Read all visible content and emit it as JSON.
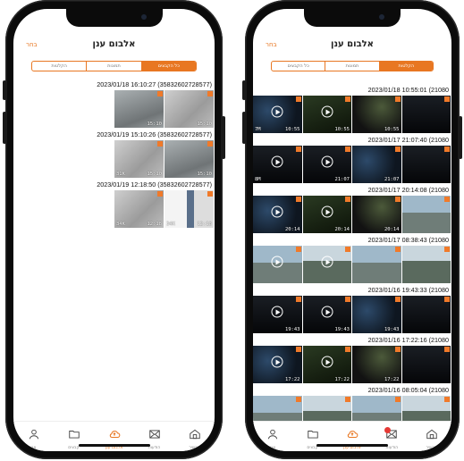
{
  "left": {
    "title": "אלבום ענן",
    "select_label": "בחר",
    "tabs": [
      {
        "label": "הקלטות",
        "active": false
      },
      {
        "label": "תמונות",
        "active": false
      },
      {
        "label": "כל הקבצים",
        "active": true
      }
    ],
    "groups": [
      {
        "header": "2023/01/18 16:10:27 (35832602728577)",
        "thumbs": [
          {
            "style": "t-grey2",
            "left": "",
            "right": "15:10"
          },
          {
            "style": "t-grey",
            "left": "",
            "right": "15:10"
          }
        ]
      },
      {
        "header": "2023/01/19 15:10:26 (35832602728577)",
        "thumbs": [
          {
            "style": "t-grey",
            "left": "31K",
            "right": "15:10"
          },
          {
            "style": "t-grey2",
            "left": "",
            "right": "15:10"
          }
        ]
      },
      {
        "header": "2023/01/19 12:18:50 (35832602728577)",
        "thumbs": [
          {
            "style": "t-grey",
            "left": "34K",
            "right": "12:18"
          },
          {
            "style": "t-room",
            "left": "34K",
            "right": "12:18"
          }
        ]
      }
    ],
    "nav": [
      {
        "icon": "person-icon",
        "label": "אני",
        "active": false
      },
      {
        "icon": "folder-icon",
        "label": "קבצים",
        "active": false
      },
      {
        "icon": "cloud-icon",
        "label": "אלבום ענן",
        "active": true
      },
      {
        "icon": "mail-icon",
        "label": "הודעות",
        "active": false
      },
      {
        "icon": "home-icon",
        "label": "מכשיר",
        "active": false
      }
    ]
  },
  "right": {
    "title": "אלבום ענן",
    "select_label": "בחר",
    "tabs": [
      {
        "label": "כל הקבצים",
        "active": false
      },
      {
        "label": "תמונות",
        "active": false
      },
      {
        "label": "הקלטות",
        "active": true
      }
    ],
    "groups": [
      {
        "header": "2023/01/18 10:55:01 (21080",
        "thumbs": [
          {
            "style": "t-night",
            "play": true,
            "left": "7M",
            "right": "10:55"
          },
          {
            "style": "t-green",
            "play": true,
            "left": "",
            "right": "10:55"
          },
          {
            "style": "t-night2",
            "play": false,
            "left": "",
            "right": "10:55"
          },
          {
            "style": "t-dark",
            "play": false,
            "left": "",
            "right": ""
          }
        ]
      },
      {
        "header": "2023/01/17 21:07:40 (21080",
        "thumbs": [
          {
            "style": "t-dark",
            "play": true,
            "left": "8M",
            "right": ""
          },
          {
            "style": "t-dark",
            "play": true,
            "left": "",
            "right": "21:07"
          },
          {
            "style": "t-night",
            "play": false,
            "left": "",
            "right": "21:07"
          },
          {
            "style": "t-dark",
            "play": false,
            "left": "",
            "right": ""
          }
        ]
      },
      {
        "header": "2023/01/17 20:14:08 (21080",
        "thumbs": [
          {
            "style": "t-night",
            "play": true,
            "left": "",
            "right": "20:14"
          },
          {
            "style": "t-green",
            "play": true,
            "left": "",
            "right": "20:14"
          },
          {
            "style": "t-night2",
            "play": false,
            "left": "",
            "right": "20:14"
          },
          {
            "style": "t-day",
            "play": false,
            "left": "",
            "right": ""
          }
        ]
      },
      {
        "header": "2023/01/17 08:38:43 (21080",
        "thumbs": [
          {
            "style": "t-day",
            "play": true,
            "left": "",
            "right": ""
          },
          {
            "style": "t-day2",
            "play": true,
            "left": "",
            "right": ""
          },
          {
            "style": "t-day",
            "play": false,
            "left": "",
            "right": ""
          },
          {
            "style": "t-day2",
            "play": false,
            "left": "",
            "right": ""
          }
        ]
      },
      {
        "header": "2023/01/16 19:43:33 (21080",
        "thumbs": [
          {
            "style": "t-dark",
            "play": true,
            "left": "",
            "right": "19:43"
          },
          {
            "style": "t-dark",
            "play": true,
            "left": "",
            "right": "19:43"
          },
          {
            "style": "t-night",
            "play": false,
            "left": "",
            "right": "19:43"
          },
          {
            "style": "t-dark",
            "play": false,
            "left": "",
            "right": ""
          }
        ]
      },
      {
        "header": "2023/01/16 17:22:16 (21080",
        "thumbs": [
          {
            "style": "t-night",
            "play": true,
            "left": "",
            "right": "17:22"
          },
          {
            "style": "t-green",
            "play": true,
            "left": "",
            "right": "17:22"
          },
          {
            "style": "t-night2",
            "play": false,
            "left": "",
            "right": "17:22"
          },
          {
            "style": "t-dark",
            "play": false,
            "left": "",
            "right": ""
          }
        ]
      },
      {
        "header": "2023/01/16 08:05:04 (21080",
        "thumbs": [
          {
            "style": "t-day",
            "play": false,
            "left": "",
            "right": ""
          },
          {
            "style": "t-day2",
            "play": false,
            "left": "",
            "right": ""
          },
          {
            "style": "t-day",
            "play": false,
            "left": "",
            "right": ""
          },
          {
            "style": "t-day2",
            "play": false,
            "left": "",
            "right": ""
          }
        ]
      }
    ],
    "nav": [
      {
        "icon": "person-icon",
        "label": "אני",
        "active": false
      },
      {
        "icon": "folder-icon",
        "label": "קבצים",
        "active": false
      },
      {
        "icon": "cloud-icon",
        "label": "אלבום ענן",
        "active": true
      },
      {
        "icon": "mail-icon",
        "label": "הודעות",
        "active": false,
        "badge": true
      },
      {
        "icon": "home-icon",
        "label": "מכשיר",
        "active": false
      }
    ]
  },
  "colors": {
    "accent": "#e87722",
    "badge": "#f07a2a",
    "notification": "#e53935"
  }
}
